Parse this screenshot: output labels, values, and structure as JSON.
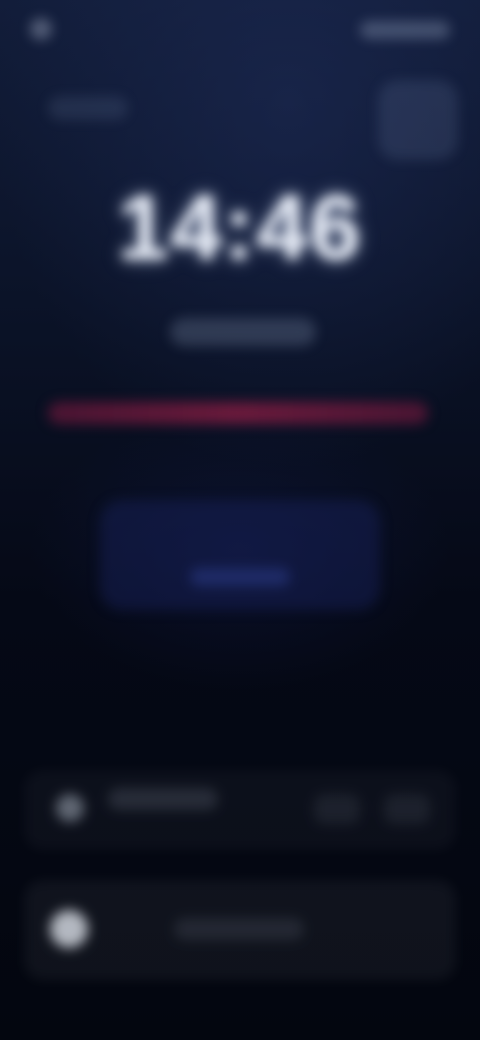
{
  "status_bar": {
    "time": "",
    "indicators_icon": "status-indicators"
  },
  "lock_screen": {
    "clock": "14:46",
    "subtitle": "",
    "alert_color": "#8c1e46"
  },
  "widgets": {
    "top_right_icon": "widget-icon",
    "center_card_color": "#1e2a6e"
  },
  "rows": [
    {
      "icon": "notification-icon",
      "label": ""
    },
    {
      "icon": "media-icon",
      "label": ""
    }
  ],
  "colors": {
    "background_top": "#121d3a",
    "background_bottom": "#03060f",
    "accent_alert": "#8c1e46"
  }
}
